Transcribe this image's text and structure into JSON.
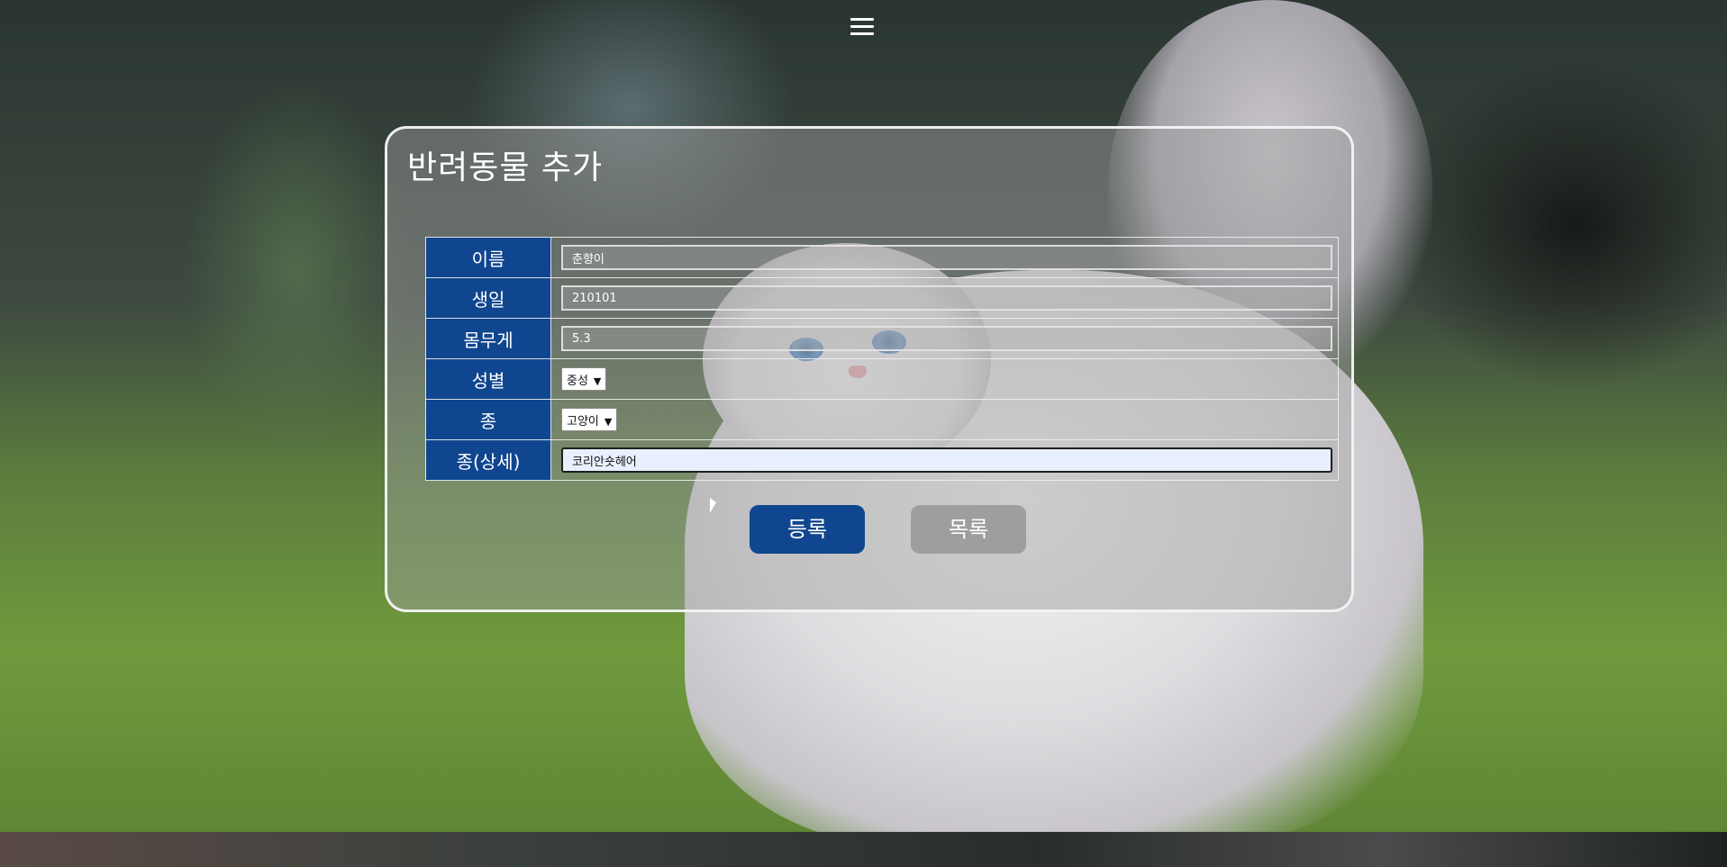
{
  "page": {
    "title": "반려동물 추가"
  },
  "header": {
    "menu_icon": "hamburger-menu-icon"
  },
  "form": {
    "rows": [
      {
        "label": "이름",
        "value": "춘향이"
      },
      {
        "label": "생일",
        "value": "210101"
      },
      {
        "label": "몸무게",
        "value": "5.3"
      },
      {
        "label": "성별",
        "selected": "중성"
      },
      {
        "label": "종",
        "selected": "고양이"
      },
      {
        "label": "종(상세)",
        "value": "코리안숏헤어"
      }
    ]
  },
  "actions": {
    "register_label": "등록",
    "list_label": "목록"
  },
  "colors": {
    "accent": "#10468f",
    "secondary_button": "#969696"
  }
}
